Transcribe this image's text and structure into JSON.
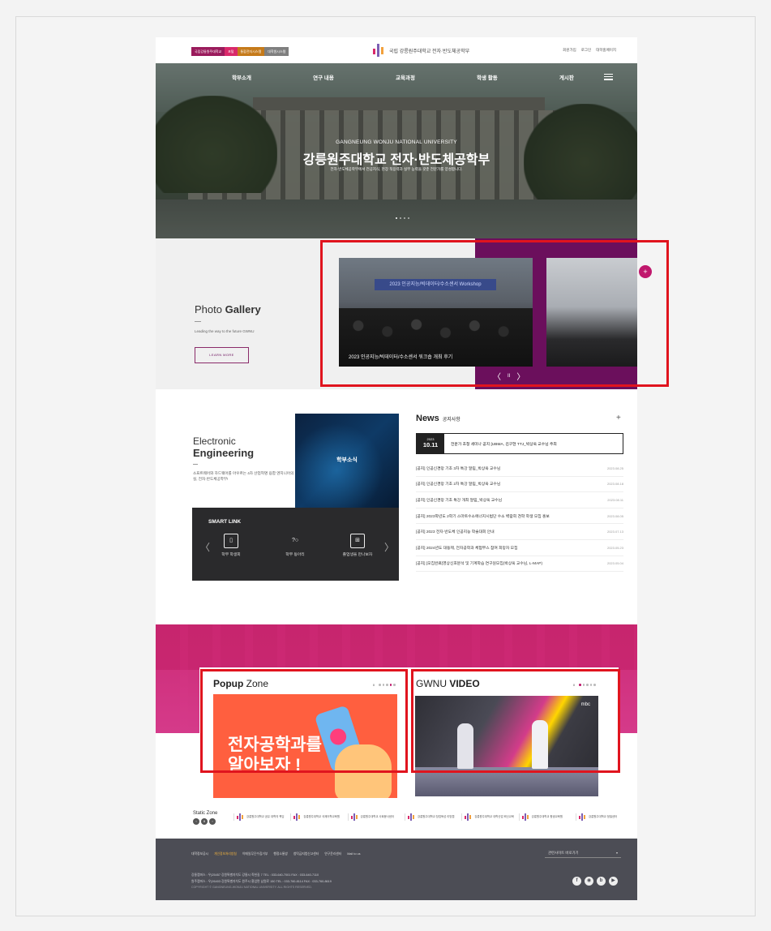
{
  "topbar": {
    "quick_links": [
      {
        "label": "국립강릉원주대학교",
        "color": "#9a1b5c"
      },
      {
        "label": "포털",
        "color": "#d9296a"
      },
      {
        "label": "통합전자시스템",
        "color": "#c57a1a"
      },
      {
        "label": "대학원시스템",
        "color": "#7f7f7f"
      }
    ],
    "logo_text": "국립 강릉원주대학교 전자·반도체공학부",
    "util": [
      "회원가입",
      "로그인",
      "대학홈페이지"
    ]
  },
  "hero": {
    "nav": [
      "학부소개",
      "연구 내용",
      "교육과정",
      "학생 활동",
      "게시판"
    ],
    "subtitle": "GANGNEUNG WONJU NATIONAL UNIVERSITY",
    "title": "강릉원주대학교 전자·반도체공학부",
    "description": "전자·반도체공학부에서 전공지식, 현장 적응력과 실무 능력을 갖춘 전문가를 양성합니다."
  },
  "gallery": {
    "title_light": "Photo ",
    "title_bold": "Gallery",
    "description": "Leading the way to the future GWNU",
    "button_label": "LEARN MORE",
    "photo1_banner": "2023 인공지능/빅데이터/수소센서 Workshop",
    "photo1_caption": "2023 인공지능/빅데이터/수소센서 워크숍 개최 후기",
    "fab": "+",
    "controls": {
      "prev": "〈",
      "pause": "II",
      "next": "〉"
    }
  },
  "electronic": {
    "title_light": "Electronic",
    "title_bold": "Engineering",
    "description": "소프트웨어와 하드웨어를 아우르는 4차 산업혁명 융합 엔지니어의 산실, 전자·반도체공학부!",
    "news_card": "학부소식"
  },
  "smart_link": {
    "title": "SMART LINK",
    "items": [
      {
        "icon": "phone-icon",
        "glyph": "▯",
        "label": "학부 학생회"
      },
      {
        "icon": "chat-icon",
        "glyph": "?○",
        "label": "학부 동아리"
      },
      {
        "icon": "profile-card-icon",
        "glyph": "⊞",
        "label": "졸업생을 만나보자"
      }
    ],
    "prev": "〈",
    "next": "〉"
  },
  "news": {
    "title": "News",
    "subtitle": "공지사항",
    "plus": "+",
    "featured": {
      "year": "2023",
      "date": "10.11",
      "text": "전문가 초청 세미나 공지 [UBMA, 김구현 TTJ_박상욱 교수님 주최"
    },
    "items": [
      {
        "text": "[공지] 인공신경망 기초 3차 특강 알림_박상욱 교수님",
        "date": "2023.08.25"
      },
      {
        "text": "[공지] 인공신경망 기초 2차 특강 알림_박상욱 교수님",
        "date": "2023.08.18"
      },
      {
        "text": "[공지] 인공신경망 기초 특강 개최 알림_박상욱 교수님",
        "date": "2023.08.11"
      },
      {
        "text": "[공지] 2023학년도 2학기 스마트수소에너지시범단 수소 벽람회 견학 학생 모집 홍보",
        "date": "2023.08.05"
      },
      {
        "text": "[공지] 2023 전자·반도체 인공지능 학술대회 안내",
        "date": "2023.07.13"
      },
      {
        "text": "[공지] 2024년도 대동제, 전자공학과 체험부스 참여 희망자 모집",
        "date": "2023.05.23"
      },
      {
        "text": "[공지] [모집완료]영상신호분석 및 기계학습 연구원모집(박상욱 교수님, L-MAP)",
        "date": "2023.05.04"
      }
    ]
  },
  "popup_zone": {
    "title_bold": "Popup",
    "title_light": " Zone",
    "pause": "II",
    "image_text_line1": "전자공학과를",
    "image_text_line2": "알아보자 !"
  },
  "video": {
    "title_light": "GWNU ",
    "title_bold": "VIDEO",
    "pause": "II",
    "watermark": "mbc"
  },
  "static_zone": {
    "title": "Static Zone",
    "controls": [
      "‹",
      "II",
      "›"
    ],
    "banners": [
      "강릉원주대학교 공유 대학의 책임",
      "강릉원주대학교 국제어학교육원",
      "강릉원주대학교 사회봉사센터",
      "강릉원주대학교 창업육성 리빙랩",
      "강릉원주대학교 대학산업 혁신교육",
      "강릉원주대학교 평생교육원",
      "강릉원주대학교 정밀센터"
    ]
  },
  "footer": {
    "links": [
      "대학정보공시",
      "개인정보처리방침",
      "이메일무단수집거부",
      "행정소통방",
      "청탁금지법신고센터",
      "연구윤리센터",
      "Mail to us"
    ],
    "highlight_index": 1,
    "select_label": "관련사이트 바로가기",
    "select_arrow": "▾",
    "address1": "강릉캠퍼스 : 우)25457 강원특별자치도 강릉시 죽헌길 7     TEL : 033-640-7001     FAX : 033-640-7110",
    "address2": "원주캠퍼스 : 우)26403 강원특별자치도 원주시 흥업면 남원로 150     TEL : 033-760-8114     FAX : 033-760-8619",
    "copyright": "COPYRIGHT © GANGNEUNG-WONJU NATIONAL UNIVERSITY. ALL RIGHTS RESERVED.",
    "social": [
      {
        "icon": "facebook-icon",
        "glyph": "f"
      },
      {
        "icon": "chat-icon",
        "glyph": "◉"
      },
      {
        "icon": "blog-icon",
        "glyph": "b"
      },
      {
        "icon": "youtube-icon",
        "glyph": "▶"
      }
    ]
  }
}
